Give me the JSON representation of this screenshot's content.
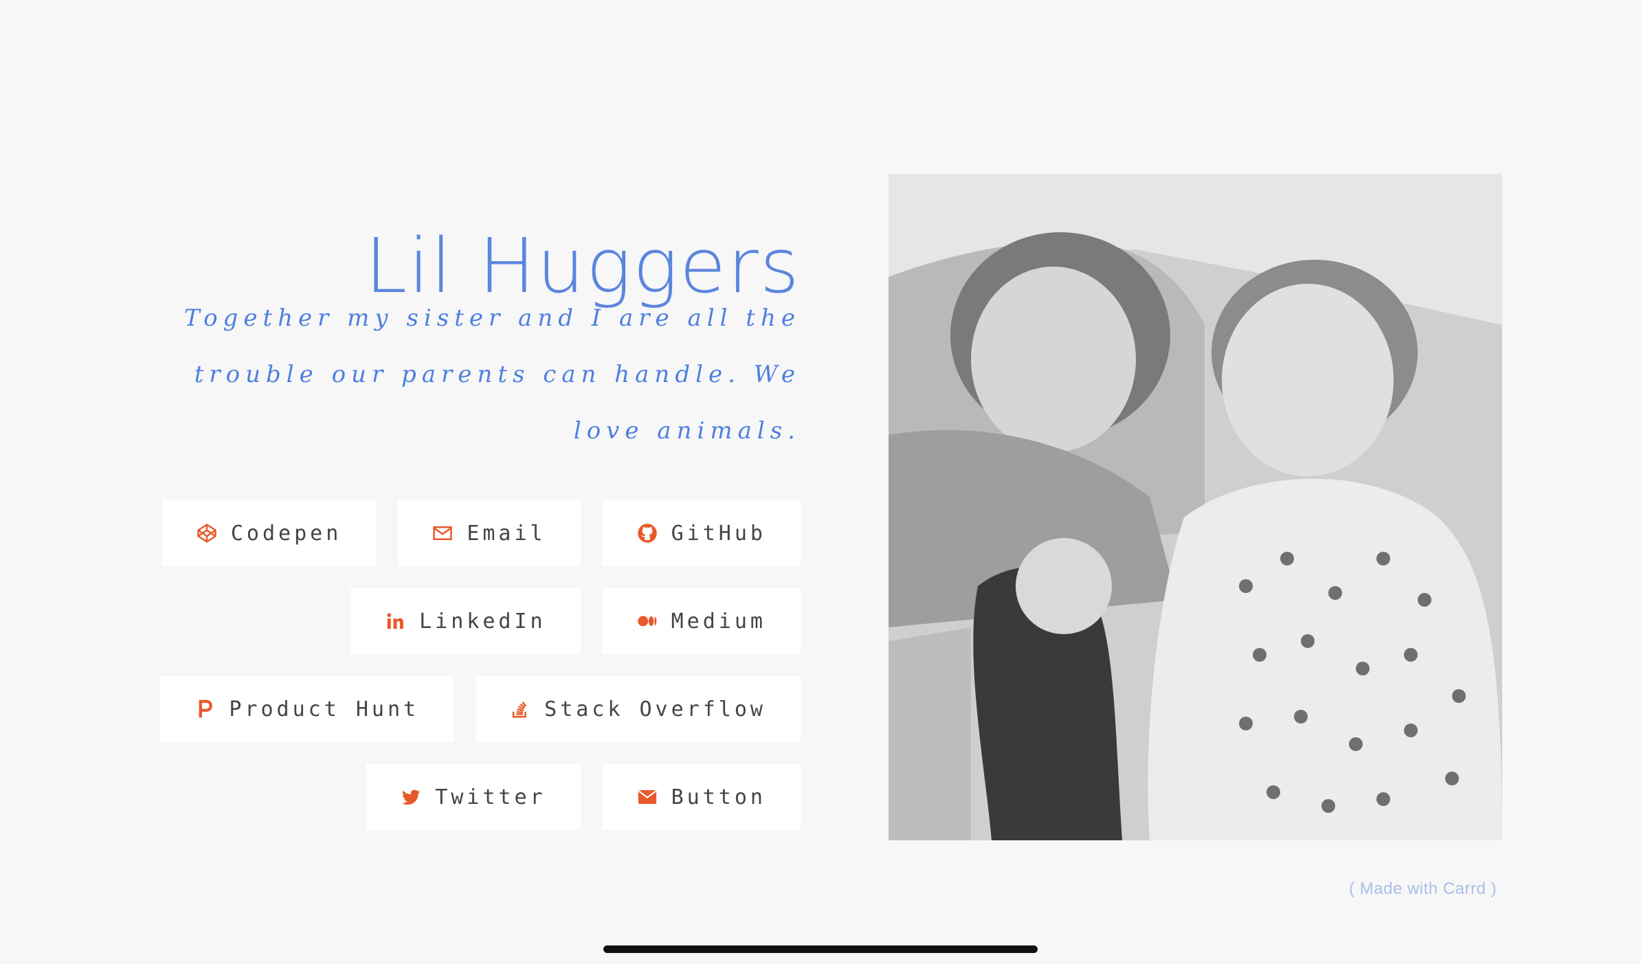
{
  "profile": {
    "title": "Lil Huggers",
    "tagline": "Together my sister and I are all the trouble our parents can handle. We love animals."
  },
  "buttons": [
    [
      {
        "label": "Codepen",
        "icon": "codepen-icon"
      },
      {
        "label": "Email",
        "icon": "envelope-outline-icon"
      },
      {
        "label": "GitHub",
        "icon": "github-icon"
      }
    ],
    [
      {
        "label": "LinkedIn",
        "icon": "linkedin-icon"
      },
      {
        "label": "Medium",
        "icon": "medium-icon"
      }
    ],
    [
      {
        "label": "Product Hunt",
        "icon": "product-hunt-icon"
      },
      {
        "label": "Stack Overflow",
        "icon": "stack-overflow-icon"
      }
    ],
    [
      {
        "label": "Twitter",
        "icon": "twitter-icon"
      },
      {
        "label": "Button",
        "icon": "envelope-filled-icon"
      }
    ]
  ],
  "footer": {
    "made_with": "( Made with Carrd )"
  },
  "colors": {
    "accent": "#5b86de",
    "icon": "#e8592a",
    "background": "#f7f7f7",
    "button_bg": "#ffffff",
    "button_text": "#444444"
  }
}
